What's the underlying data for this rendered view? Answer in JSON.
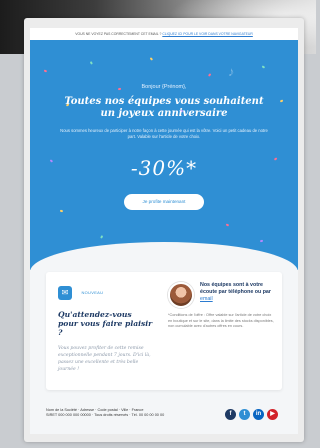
{
  "preheader": {
    "text": "VOUS NE VOYEZ PAS CORRECTEMENT CET EMAIL ?",
    "link": "CLIQUEZ ICI POUR LE VOIR DANS VOTRE NAVIGATEUR"
  },
  "hero": {
    "greeting": "Bonjour {Prénom},",
    "title": "Toutes nos équipes vous souhaitent un joyeux anniversaire",
    "intro": "Nous sommes heureux de participer à notre façon à cette journée qui est la vôtre. Voici un petit cadeau de notre part. Valable sur l'article de votre choix.",
    "discount": "-30%*",
    "cta_label": "Je profite maintenant"
  },
  "card_left": {
    "badge_icon": "gift-icon",
    "badge_label": "NOUVEAU",
    "title": "Qu'attendez-vous pour vous faire plaisir ?",
    "body": "Vous pouvez profiter de cette remise exceptionnelle pendant 7 jours. D'ici là, passez une excellente et très belle journée !"
  },
  "card_right": {
    "contact_prefix": "Nos équipes sont à votre écoute par téléphone ou par",
    "contact_link": "email",
    "note": "*Conditions de l'offre : Offre valable sur l'article de votre choix en boutique et sur le site, dans la limite des stocks disponibles, non cumulable avec d'autres offres en cours."
  },
  "footer": {
    "line1": "Nom de la Société · Adresse · Code postal · Ville · France",
    "line2": "SIRET 000 000 000 00000 · Tous droits réservés · Tél. 00 00 00 00 00",
    "social": [
      "facebook-icon",
      "twitter-icon",
      "linkedin-icon",
      "youtube-icon"
    ]
  },
  "colors": {
    "hero_blue": "#2f8fd4",
    "navy": "#1e3a64",
    "youtube_red": "#d2232a"
  }
}
